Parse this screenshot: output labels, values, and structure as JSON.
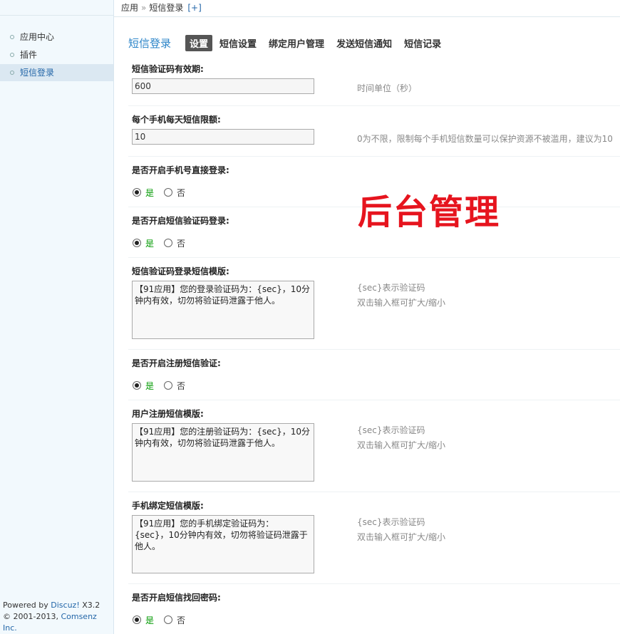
{
  "breadcrumb": {
    "root": "应用",
    "sep": "»",
    "current": "短信登录",
    "add": "[+]"
  },
  "sidebar": {
    "items": [
      {
        "label": "应用中心",
        "active": false
      },
      {
        "label": "插件",
        "active": false
      },
      {
        "label": "短信登录",
        "active": true
      }
    ],
    "footer": {
      "powered_prefix": "Powered by ",
      "powered_brand": "Discuz!",
      "powered_version": " X3.2",
      "copyright_prefix": "© 2001-2013, ",
      "copyright_brand": "Comsenz Inc."
    }
  },
  "tabs": {
    "title": "短信登录",
    "items": [
      "设置",
      "短信设置",
      "绑定用户管理",
      "发送短信通知",
      "短信记录"
    ]
  },
  "overlay_text": "后台管理",
  "form": {
    "expiry": {
      "label": "短信验证码有效期:",
      "value": "600",
      "tip": "时间单位（秒）"
    },
    "daily_limit": {
      "label": "每个手机每天短信限额:",
      "value": "10",
      "tip": "0为不限，限制每个手机短信数量可以保护资源不被滥用，建议为10"
    },
    "phone_login": {
      "label": "是否开启手机号直接登录:",
      "yes": "是",
      "no": "否"
    },
    "code_login": {
      "label": "是否开启短信验证码登录:",
      "yes": "是",
      "no": "否"
    },
    "login_template": {
      "label": "短信验证码登录短信模版:",
      "value": "【91应用】您的登录验证码为：{sec}，10分钟内有效，切勿将验证码泄露于他人。",
      "tip1": "{sec}表示验证码",
      "tip2": "双击输入框可扩大/缩小"
    },
    "register_verify": {
      "label": "是否开启注册短信验证:",
      "yes": "是",
      "no": "否"
    },
    "register_template": {
      "label": "用户注册短信模版:",
      "value": "【91应用】您的注册验证码为：{sec}，10分钟内有效，切勿将验证码泄露于他人。",
      "tip1": "{sec}表示验证码",
      "tip2": "双击输入框可扩大/缩小"
    },
    "bind_template": {
      "label": "手机绑定短信模版:",
      "value": "【91应用】您的手机绑定验证码为：\n{sec}，10分钟内有效，切勿将验证码泄露于他人。",
      "tip1": "{sec}表示验证码",
      "tip2": "双击输入框可扩大/缩小"
    },
    "recover": {
      "label": "是否开启短信找回密码:",
      "yes": "是",
      "no": "否"
    }
  }
}
